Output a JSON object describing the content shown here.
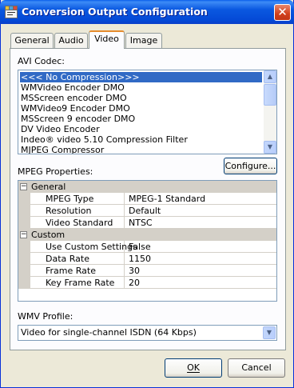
{
  "window": {
    "title": "Conversion Output Configuration",
    "close": "✕"
  },
  "tabs": [
    {
      "label": "General"
    },
    {
      "label": "Audio"
    },
    {
      "label": "Video",
      "active": true
    },
    {
      "label": "Image"
    }
  ],
  "avi": {
    "label": "AVI Codec:",
    "items": [
      "<<< No Compression>>>",
      "WMVideo Encoder DMO",
      "MSScreen encoder DMO",
      "WMVideo9 Encoder DMO",
      "MSScreen 9 encoder DMO",
      "DV Video Encoder",
      "Indeo® video 5.10 Compression Filter",
      "MJPEG Compressor"
    ],
    "selected_index": 0,
    "scroll_up": "▲",
    "scroll_down": "▼"
  },
  "configure_button": "Configure...",
  "mpeg": {
    "label": "MPEG Properties:",
    "categories": [
      {
        "name": "General",
        "toggle": "−",
        "rows": [
          {
            "name": "MPEG Type",
            "value": "MPEG-1 Standard"
          },
          {
            "name": "Resolution",
            "value": "Default"
          },
          {
            "name": "Video Standard",
            "value": "NTSC"
          }
        ]
      },
      {
        "name": "Custom",
        "toggle": "−",
        "rows": [
          {
            "name": "Use Custom Settings",
            "value": "False"
          },
          {
            "name": "Data Rate",
            "value": "1150"
          },
          {
            "name": "Frame Rate",
            "value": "30"
          },
          {
            "name": "Key Frame Rate",
            "value": "20"
          }
        ]
      }
    ]
  },
  "wmv": {
    "label": "WMV Profile:",
    "value": "Video for single-channel ISDN (64 Kbps)",
    "arrow": "▼"
  },
  "buttons": {
    "ok": "OK",
    "cancel": "Cancel"
  },
  "colors": {
    "selection": "#316ac5",
    "title_bar": "#0a58e0",
    "active_tab_accent": "#e68b2c"
  }
}
